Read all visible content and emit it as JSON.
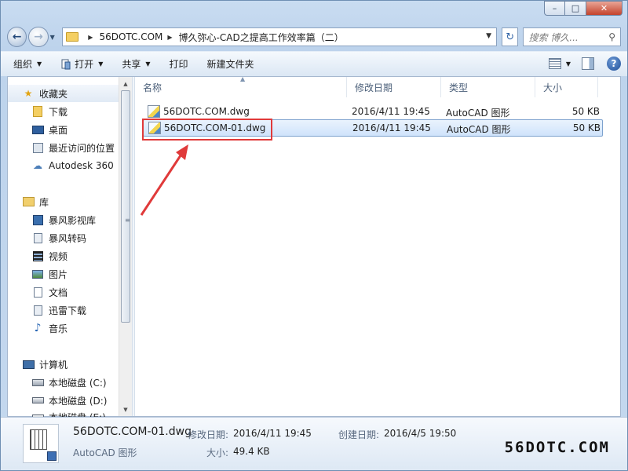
{
  "window": {
    "caption_buttons": {
      "minimize": "–",
      "maximize": "□",
      "close": "✕"
    }
  },
  "address_bar": {
    "crumbs": [
      "56DOTC.COM",
      "博久弥心-CAD之提高工作效率篇（二）"
    ],
    "search_placeholder": "搜索 博久..."
  },
  "toolbar": {
    "organize": "组织",
    "open": "打开",
    "share": "共享",
    "print": "打印",
    "new_folder": "新建文件夹"
  },
  "sidebar": {
    "favorites": {
      "label": "收藏夹",
      "items": [
        "下载",
        "桌面",
        "最近访问的位置",
        "Autodesk 360"
      ]
    },
    "libraries": {
      "label": "库",
      "items": [
        "暴风影视库",
        "暴风转码",
        "视频",
        "图片",
        "文档",
        "迅雷下载",
        "音乐"
      ]
    },
    "computer": {
      "label": "计算机",
      "items": [
        "本地磁盘 (C:)",
        "本地磁盘 (D:)",
        "本地磁盘 (E:)"
      ]
    }
  },
  "file_list": {
    "columns": [
      "名称",
      "修改日期",
      "类型",
      "大小"
    ],
    "rows": [
      {
        "name": "56DOTC.COM.dwg",
        "modified": "2016/4/11 19:45",
        "type": "AutoCAD 图形",
        "size": "50 KB",
        "selected": false
      },
      {
        "name": "56DOTC.COM-01.dwg",
        "modified": "2016/4/11 19:45",
        "type": "AutoCAD 图形",
        "size": "50 KB",
        "selected": true
      }
    ]
  },
  "details": {
    "filename": "56DOTC.COM-01.dwg",
    "filetype": "AutoCAD 图形",
    "modified_label": "修改日期:",
    "modified_value": "2016/4/11 19:45",
    "created_label": "创建日期:",
    "created_value": "2016/4/5 19:50",
    "size_label": "大小:",
    "size_value": "49.4 KB"
  },
  "watermark": "56DOTC.COM",
  "colors": {
    "highlight": "#e03a3a",
    "selection": "#cfe3fb",
    "frame": "#c4d8ee"
  }
}
